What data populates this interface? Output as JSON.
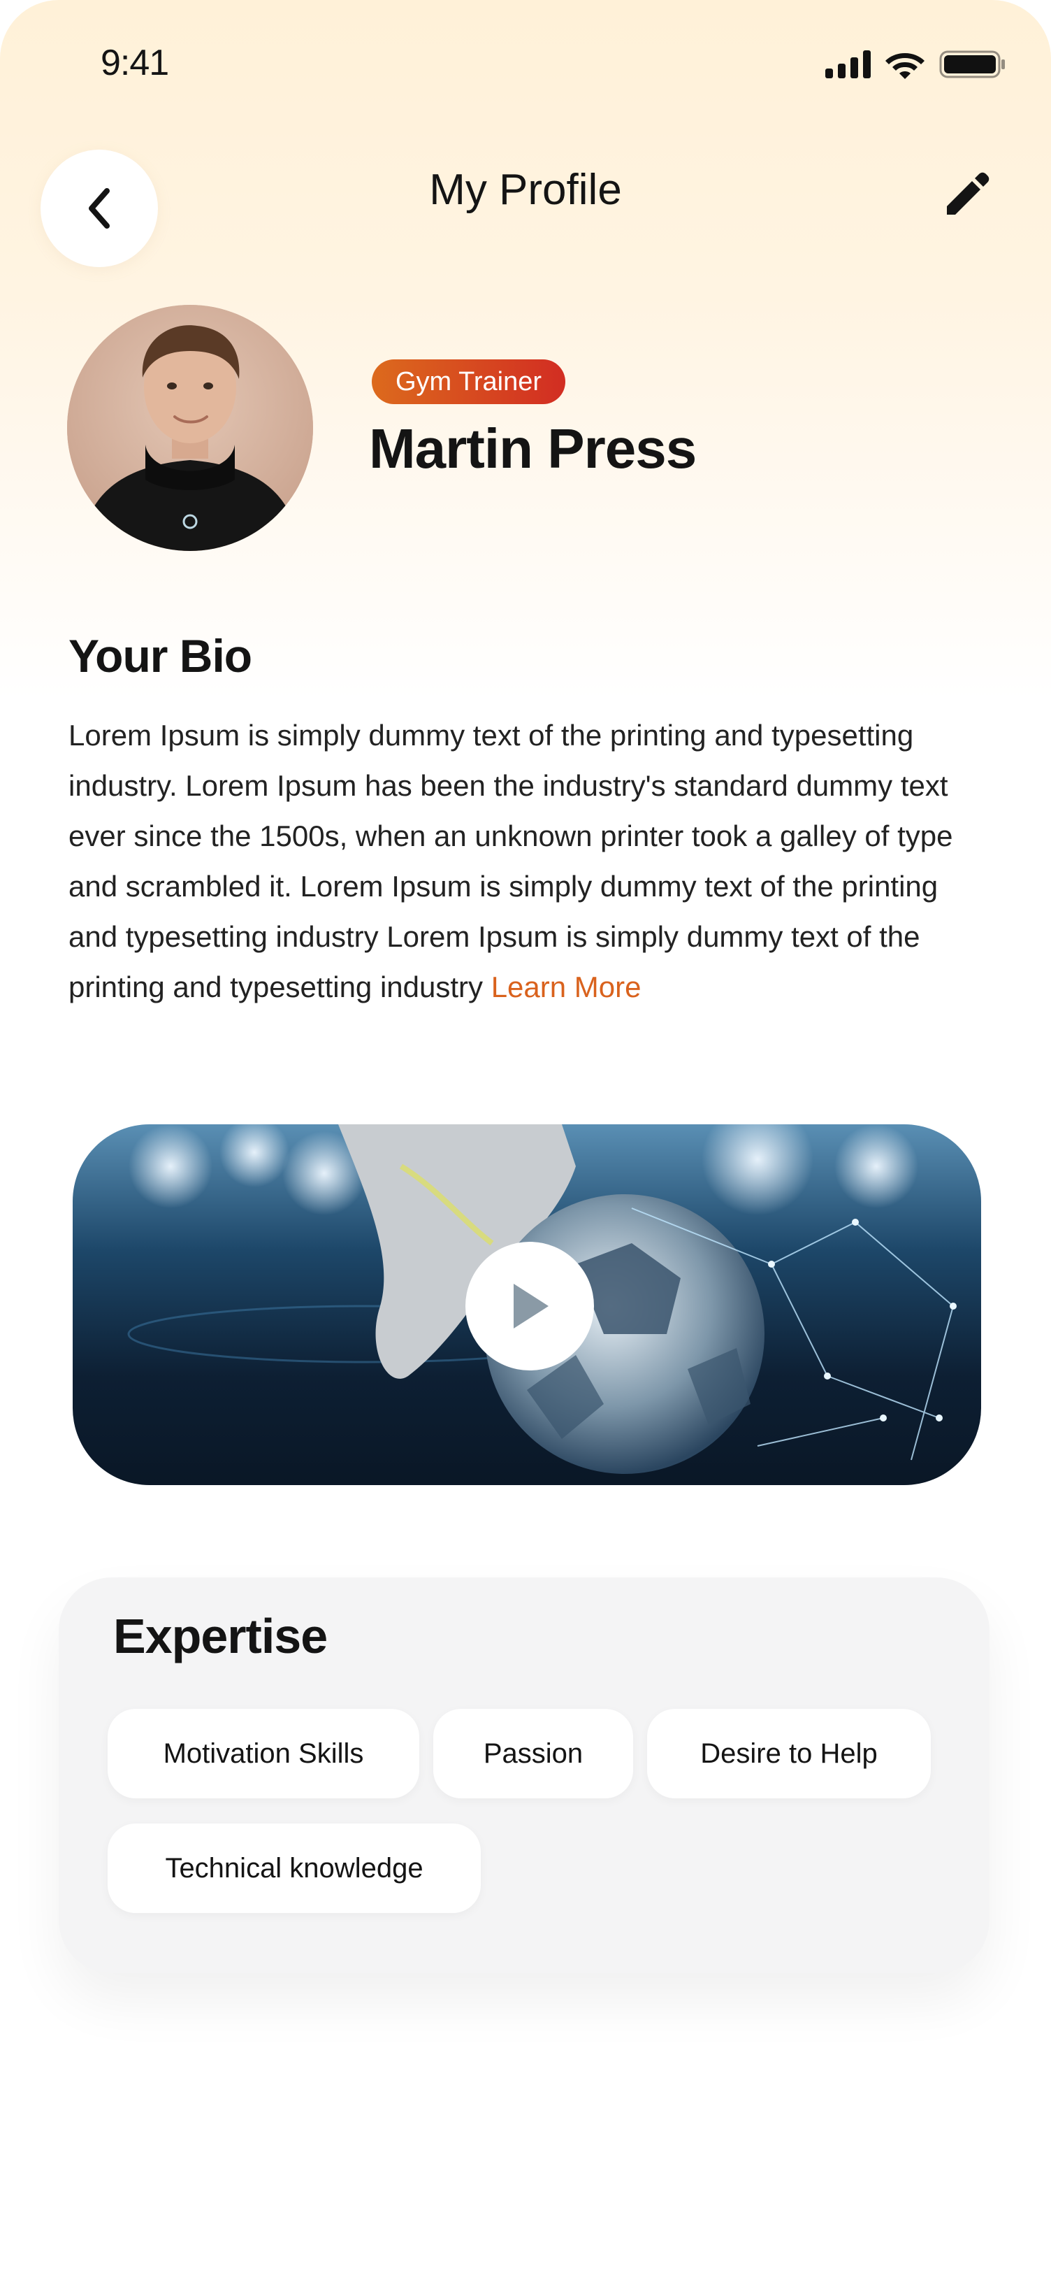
{
  "status_bar": {
    "time": "9:41"
  },
  "header": {
    "title": "My Profile"
  },
  "profile": {
    "badge": "Gym Trainer",
    "name": "Martin Press"
  },
  "bio": {
    "title": "Your Bio",
    "text": "Lorem Ipsum is simply dummy text of the printing and typesetting industry. Lorem Ipsum has been the industry's standard dummy text ever since the 1500s, when an unknown printer took a galley of type and scrambled it. Lorem Ipsum is simply dummy text of the printing and typesetting industry Lorem Ipsum is simply dummy text of the printing and typesetting industry",
    "link": "Learn More"
  },
  "expertise": {
    "title": "Expertise",
    "chips": [
      "Motivation Skills",
      "Passion",
      "Desire to Help",
      "Technical knowledge"
    ]
  },
  "colors": {
    "accent": "#d9621d",
    "badge_start": "#dc6a1d",
    "badge_end": "#d22d22"
  },
  "icons": {
    "back": "chevron-left-icon",
    "edit": "pencil-icon",
    "play": "play-icon"
  }
}
